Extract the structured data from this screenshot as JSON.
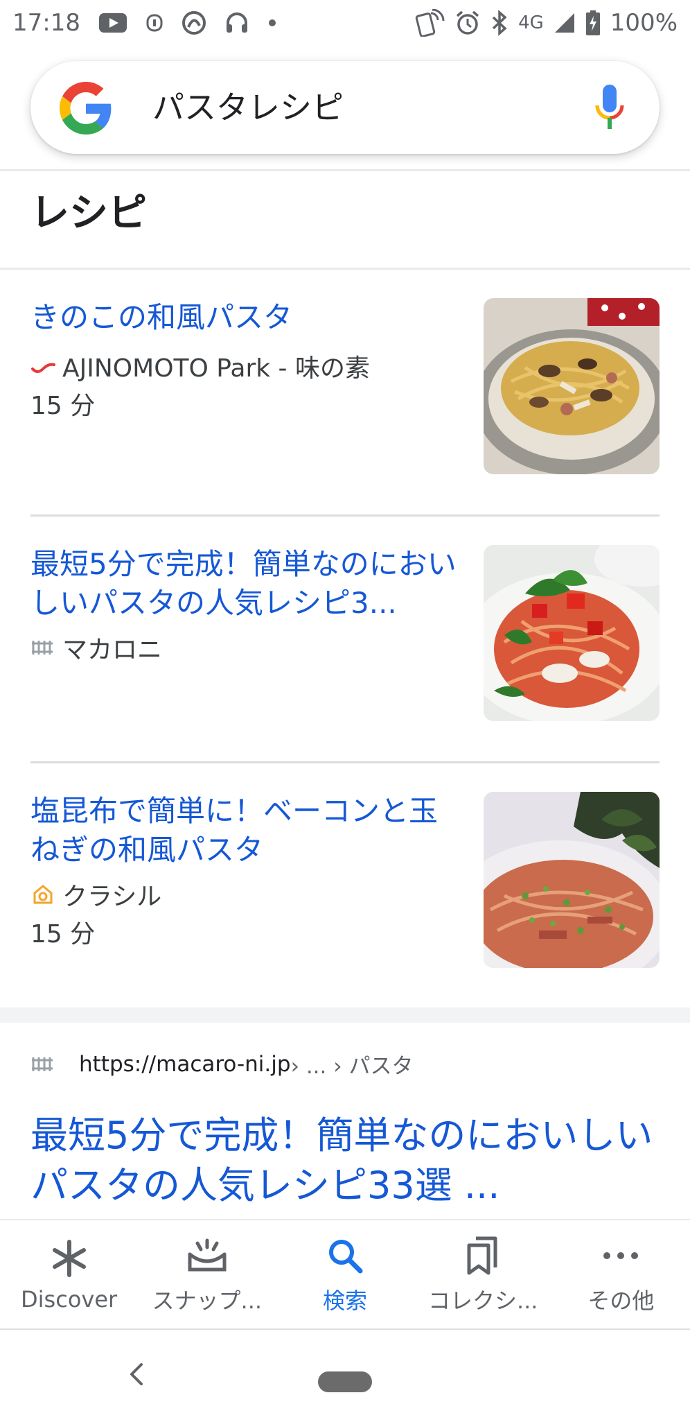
{
  "status_bar": {
    "time": "17:18",
    "network": "4G",
    "battery": "100%",
    "left_icons": [
      "youtube-icon",
      "notification-icon",
      "app-icon",
      "headset-icon",
      "dot-icon"
    ],
    "right_icons": [
      "nfc-icon",
      "alarm-icon",
      "bluetooth-icon",
      "signal-icon",
      "battery-icon"
    ]
  },
  "search": {
    "query": "パスタレシピ"
  },
  "recipes_section": {
    "title": "レシピ",
    "items": [
      {
        "title": "きのこの和風パスタ",
        "source": "AJINOMOTO Park - 味の素",
        "time": "15 分"
      },
      {
        "title": "最短5分で完成！簡単なのにおいしいパスタの人気レシピ3...",
        "source": "マカロニ",
        "time": ""
      },
      {
        "title": "塩昆布で簡単に！ベーコンと玉ねぎの和風パスタ",
        "source": "クラシル",
        "time": "15 分"
      }
    ]
  },
  "web_result": {
    "url_host": "https://macaro-ni.jp",
    "url_crumbs": " › ... › パスタ",
    "title": "最短5分で完成！簡単なのにおいしいパスタの人気レシピ33選 ..."
  },
  "bottom_nav": {
    "items": [
      {
        "label": "Discover",
        "icon": "asterisk-icon"
      },
      {
        "label": "スナップ...",
        "icon": "snapshot-icon"
      },
      {
        "label": "検索",
        "icon": "search-icon"
      },
      {
        "label": "コレクシ...",
        "icon": "collections-icon"
      },
      {
        "label": "その他",
        "icon": "more-icon"
      }
    ],
    "active": "検索"
  },
  "colors": {
    "link": "#1558d6",
    "active_nav": "#1a73e8",
    "text": "#202124",
    "secondary": "#5f6368"
  }
}
